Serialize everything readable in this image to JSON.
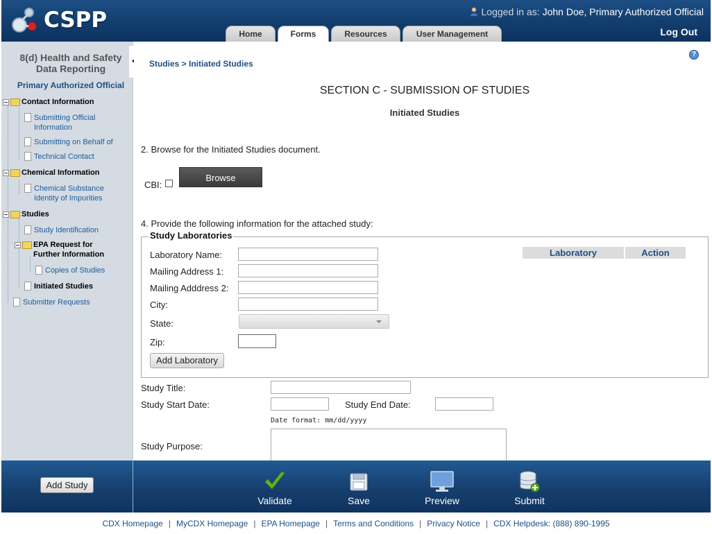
{
  "header": {
    "logo_text": "CSPP",
    "logged_in_label": "Logged in as:",
    "logged_in_user": "John Doe, Primary Authorized Official",
    "logout": "Log Out",
    "tabs": [
      {
        "label": "Home"
      },
      {
        "label": "Forms"
      },
      {
        "label": "Resources"
      },
      {
        "label": "User Management"
      }
    ],
    "active_tab": "Forms"
  },
  "sidebar": {
    "title_line1": "8(d) Health and Safety",
    "title_line2": "Data Reporting",
    "role": "Primary Authorized Official",
    "tree": [
      {
        "label": "Contact Information"
      },
      {
        "label1": "Submitting Official",
        "label2": "Information"
      },
      {
        "label": "Submitting on Behalf of"
      },
      {
        "label": "Technical Contact"
      },
      {
        "label": "Chemical Information"
      },
      {
        "label1": "Chemical Substance",
        "label2": "Identity of Impurities"
      },
      {
        "label": "Studies"
      },
      {
        "label": "Study Identification"
      },
      {
        "label1": "EPA Request for",
        "label2": "Further Information"
      },
      {
        "label": "Copies of Studies"
      },
      {
        "label": "Initiated Studies"
      },
      {
        "label": "Submitter Requests"
      }
    ]
  },
  "main": {
    "breadcrumb": "Studies > Initiated Studies",
    "section_title": "SECTION C - SUBMISSION OF STUDIES",
    "sub_title": "Initiated Studies",
    "step2": "2. Browse for the Initiated Studies document.",
    "cbi_label": "CBI:",
    "browse_label": "Browse",
    "step4": "4. Provide the following information for the attached study:",
    "labs": {
      "legend": "Study Laboratories",
      "fields": {
        "lab_name": "Laboratory Name:",
        "addr1": "Mailing Address 1:",
        "addr2": "Mailing Adddress 2:",
        "city": "City:",
        "state": "State:",
        "zip": "Zip:"
      },
      "add_button": "Add Laboratory",
      "table_headers": [
        "Laboratory",
        "Action"
      ]
    },
    "study_title_label": "Study Title:",
    "start_date_label": "Study Start Date:",
    "end_date_label": "Study End Date:",
    "date_hint": "Date format: mm/dd/yyyy",
    "purpose_label": "Study Purpose:"
  },
  "toolbar": {
    "add_study": "Add Study",
    "validate": "Validate",
    "save": "Save",
    "preview": "Preview",
    "submit": "Submit"
  },
  "footer": {
    "links": [
      "CDX Homepage",
      "MyCDX Homepage",
      "EPA Homepage",
      "Terms and Conditions",
      "Privacy Notice",
      "CDX Helpdesk: (888) 890-1995"
    ]
  },
  "colors": {
    "header_blue": "#123d6d",
    "link_blue": "#1f4e80",
    "sidebar_bg": "#d4dbe2",
    "validate_green": "#5aa52c"
  },
  "icons": {
    "user": "user-icon",
    "help": "help-icon",
    "validate": "checkmark-icon",
    "save": "floppy-disk-icon",
    "preview": "monitor-icon",
    "submit": "database-add-icon"
  }
}
